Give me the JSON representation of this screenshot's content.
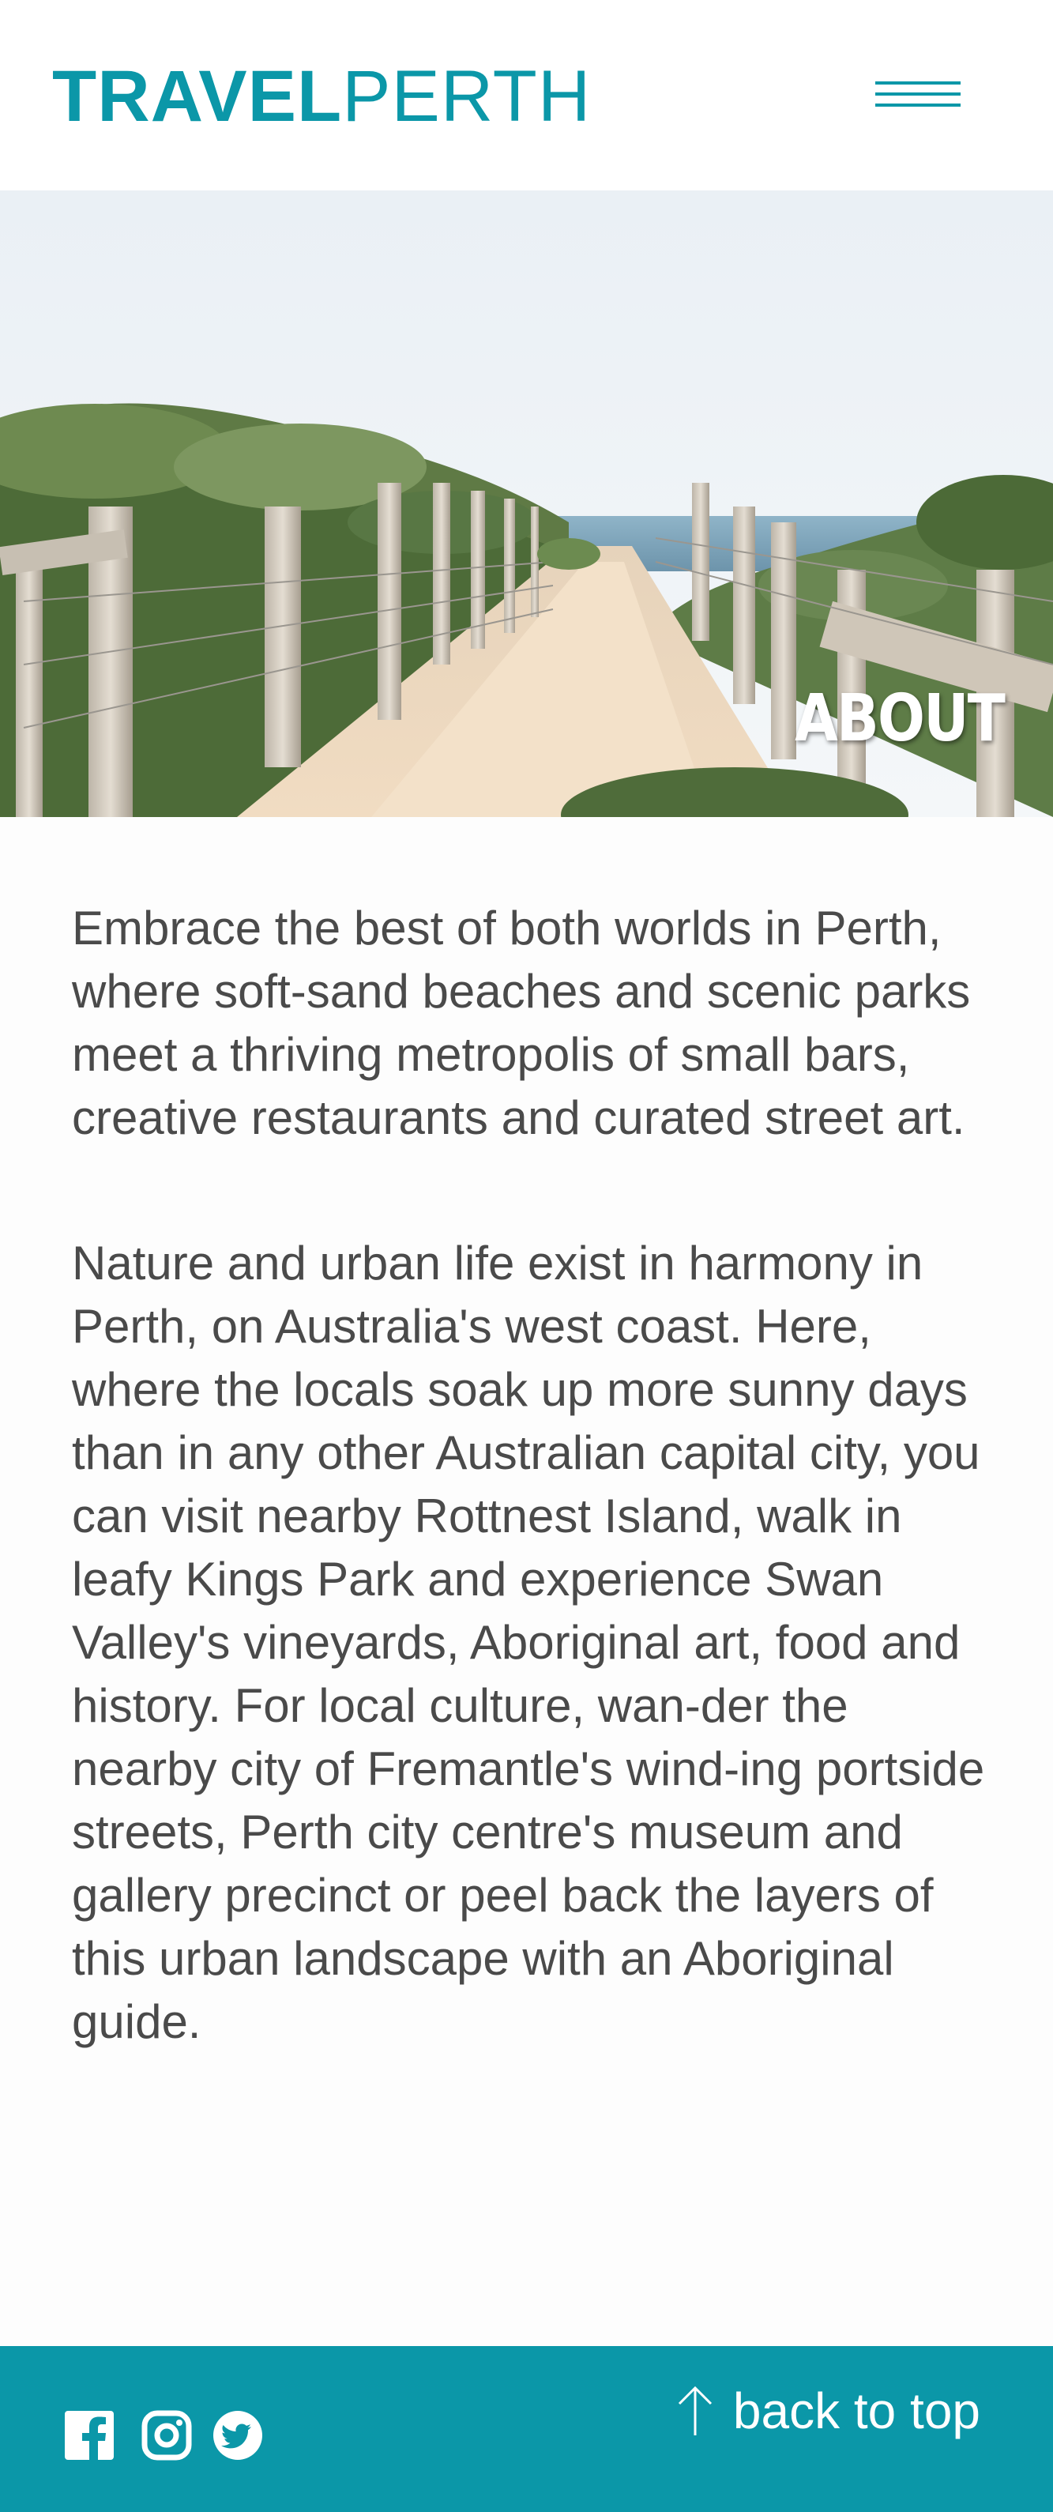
{
  "header": {
    "logo_bold": "TRAVEL",
    "logo_light": "PERTH",
    "menu_icon": "hamburger-menu-icon"
  },
  "hero": {
    "title": "ABOUT",
    "image": "beach-path-fence-photo"
  },
  "content": {
    "paragraphs": [
      "Embrace the best of both worlds in Perth, where soft-sand beaches and scenic parks meet a thriving metropolis of small bars, creative restaurants and curated street art.",
      "Nature and urban life exist in harmony in Perth, on Australia's west coast. Here, where the locals soak up more sunny days than in any other Australian capital city, you can visit nearby Rottnest Island, walk in leafy Kings Park and experience Swan Valley's vineyards, Aboriginal art, food and history. For local culture, wan-der the nearby city of Fremantle's wind-ing portside streets, Perth city centre's museum and gallery precinct or peel back the layers of this urban landscape with an Aboriginal guide."
    ]
  },
  "footer": {
    "social_icons": [
      "facebook-icon",
      "instagram-icon",
      "twitter-icon"
    ],
    "back_to_top": "back to top",
    "back_icon": "arrow-up-icon"
  },
  "colors": {
    "brand": "#0b97a8",
    "text": "#4a4a4a",
    "footer_bg": "#0b97a8",
    "hero_text": "#ffffff"
  }
}
